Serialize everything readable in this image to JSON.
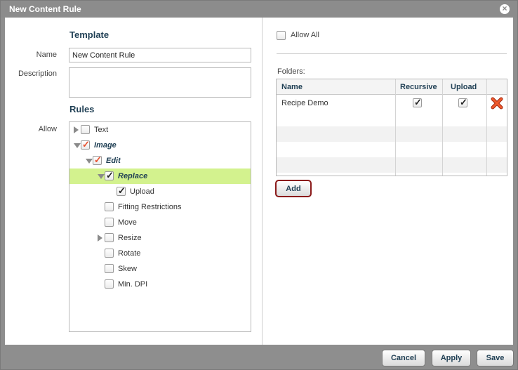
{
  "dialog": {
    "title": "New Content Rule",
    "close_icon": "close-circle-icon"
  },
  "template": {
    "section_title": "Template",
    "name_label": "Name",
    "name_value": "New Content Rule",
    "description_label": "Description",
    "description_value": ""
  },
  "rules": {
    "section_title": "Rules",
    "allow_label": "Allow",
    "tree": [
      {
        "label": "Text",
        "level": 0,
        "expander": "collapsed",
        "check": "none",
        "emphasis": false,
        "selected": false
      },
      {
        "label": "Image",
        "level": 0,
        "expander": "expanded",
        "check": "partial",
        "emphasis": true,
        "selected": false
      },
      {
        "label": "Edit",
        "level": 1,
        "expander": "expanded",
        "check": "partial",
        "emphasis": true,
        "selected": false
      },
      {
        "label": "Replace",
        "level": 2,
        "expander": "expanded",
        "check": "checked",
        "emphasis": true,
        "selected": true
      },
      {
        "label": "Upload",
        "level": 3,
        "expander": "none",
        "check": "checked",
        "emphasis": false,
        "selected": false
      },
      {
        "label": "Fitting Restrictions",
        "level": 2,
        "expander": "none",
        "check": "none",
        "emphasis": false,
        "selected": false
      },
      {
        "label": "Move",
        "level": 2,
        "expander": "none",
        "check": "none",
        "emphasis": false,
        "selected": false
      },
      {
        "label": "Resize",
        "level": 2,
        "expander": "collapsed",
        "check": "none",
        "emphasis": false,
        "selected": false
      },
      {
        "label": "Rotate",
        "level": 2,
        "expander": "none",
        "check": "none",
        "emphasis": false,
        "selected": false
      },
      {
        "label": "Skew",
        "level": 2,
        "expander": "none",
        "check": "none",
        "emphasis": false,
        "selected": false
      },
      {
        "label": "Min. DPI",
        "level": 2,
        "expander": "none",
        "check": "none",
        "emphasis": false,
        "selected": false
      }
    ]
  },
  "folders": {
    "allow_all_label": "Allow All",
    "allow_all_checked": false,
    "folders_label": "Folders:",
    "columns": [
      "Name",
      "Recursive",
      "Upload"
    ],
    "rows": [
      {
        "name": "Recipe Demo",
        "recursive": true,
        "upload": true
      }
    ],
    "delete_icon": "red-x-delete-icon",
    "add_label": "Add"
  },
  "footer": {
    "cancel_label": "Cancel",
    "apply_label": "Apply",
    "save_label": "Save"
  },
  "colors": {
    "selected_row": "#d3f28e",
    "partial_check": "#e8502e",
    "heading": "#1f3f54",
    "add_button_border": "#8b1a1a"
  }
}
